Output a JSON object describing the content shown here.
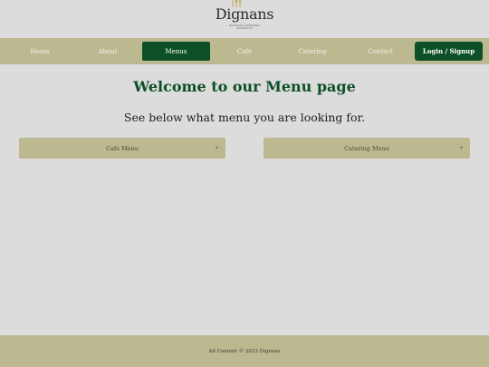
{
  "brand": {
    "name": "Dignans",
    "tagline": "Outside Catering",
    "location": "Edinburgh"
  },
  "nav": {
    "items": [
      {
        "label": "Home",
        "active": false
      },
      {
        "label": "About",
        "active": false
      },
      {
        "label": "Menus",
        "active": true
      },
      {
        "label": "Cafe",
        "active": false
      },
      {
        "label": "Catering",
        "active": false
      },
      {
        "label": "Contact",
        "active": false
      }
    ],
    "login_label": "Login / Signup"
  },
  "main": {
    "title": "Welcome to our Menu page",
    "subtitle": "See below what menu you are looking for.",
    "accordions": [
      {
        "label": "Cafe Menu",
        "toggle": "+"
      },
      {
        "label": "Catering Menu",
        "toggle": "+"
      }
    ]
  },
  "footer": {
    "text": "All Content © 2023 Dignans"
  },
  "colors": {
    "accent": "#0d4f26",
    "nav_background": "#bcb890",
    "page_background": "#dcdcdc"
  }
}
